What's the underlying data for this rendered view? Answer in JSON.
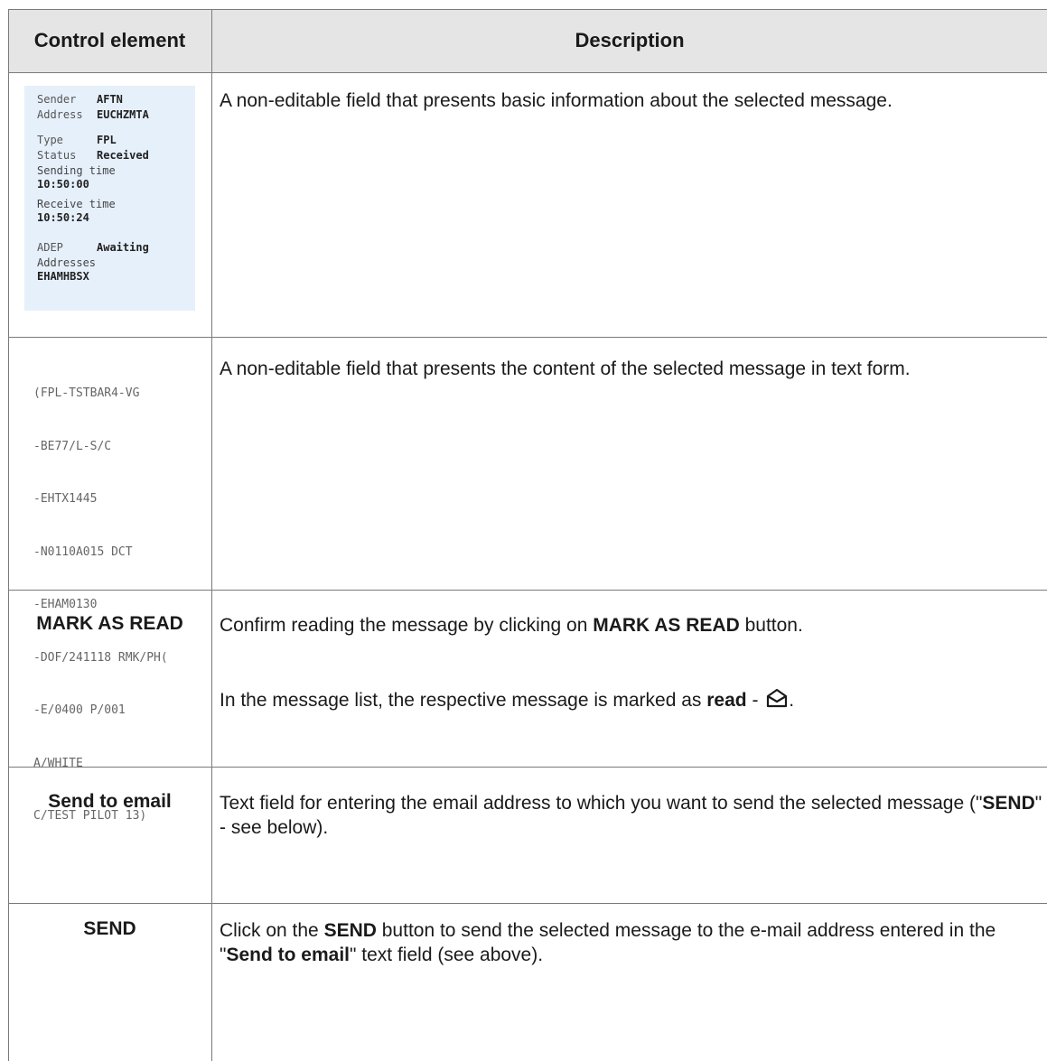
{
  "table": {
    "headers": {
      "control": "Control element",
      "description": "Description"
    },
    "rows": [
      {
        "control": "",
        "description": "A non-editable field that presents basic information about the selected message.",
        "panel": {
          "sender_label": "Sender",
          "sender_value": "AFTN",
          "address_label": "Address",
          "address_value": "EUCHZMTA",
          "type_label": "Type",
          "type_value": "FPL",
          "status_label": "Status",
          "status_value": "Received",
          "sending_time_label": "Sending time",
          "sending_time_value": "10:50:00",
          "receive_time_label": "Receive time",
          "receive_time_value": "10:50:24",
          "adep_label": "ADEP",
          "adep_value": "Awaiting",
          "addresses_label": "Addresses",
          "addresses_value": "EHAMHBSX"
        }
      },
      {
        "control": "",
        "description": "A non-editable field that presents the content of the selected message in text form.",
        "message_lines": [
          "(FPL-TSTBAR4-VG",
          "-BE77/L-S/C",
          "-EHTX1445",
          "-N0110A015 DCT",
          "-EHAM0130",
          "-DOF/241118 RMK/PH(",
          "-E/0400 P/001",
          "A/WHITE",
          "C/TEST PILOT 13)"
        ]
      },
      {
        "control": "MARK AS READ",
        "desc_1_prefix": "Confirm reading the message by clicking on ",
        "desc_1_bold": "MARK AS READ",
        "desc_1_suffix": " button.",
        "desc_2_prefix": "In the message list, the respective message is marked as ",
        "desc_2_bold": "read",
        "desc_2_suffix": " - ",
        "desc_2_end": ".",
        "icon": "envelope-open-icon"
      },
      {
        "control": "Send to email",
        "desc_prefix": "Text field for entering the email address to which you want to send the selected message (\"",
        "desc_bold": "SEND",
        "desc_suffix": "\" - see below)."
      },
      {
        "control": "SEND",
        "desc_prefix": "Click on the ",
        "desc_bold_1": "SEND",
        "desc_mid": " button to send the selected message to the e-mail address entered in the \"",
        "desc_bold_2": "Send to email",
        "desc_suffix": "\" text field (see above)."
      }
    ]
  },
  "colors": {
    "header_bg": "#e5e5e5",
    "panel_bg": "#e6f0fb",
    "border": "#7a7a7a"
  }
}
